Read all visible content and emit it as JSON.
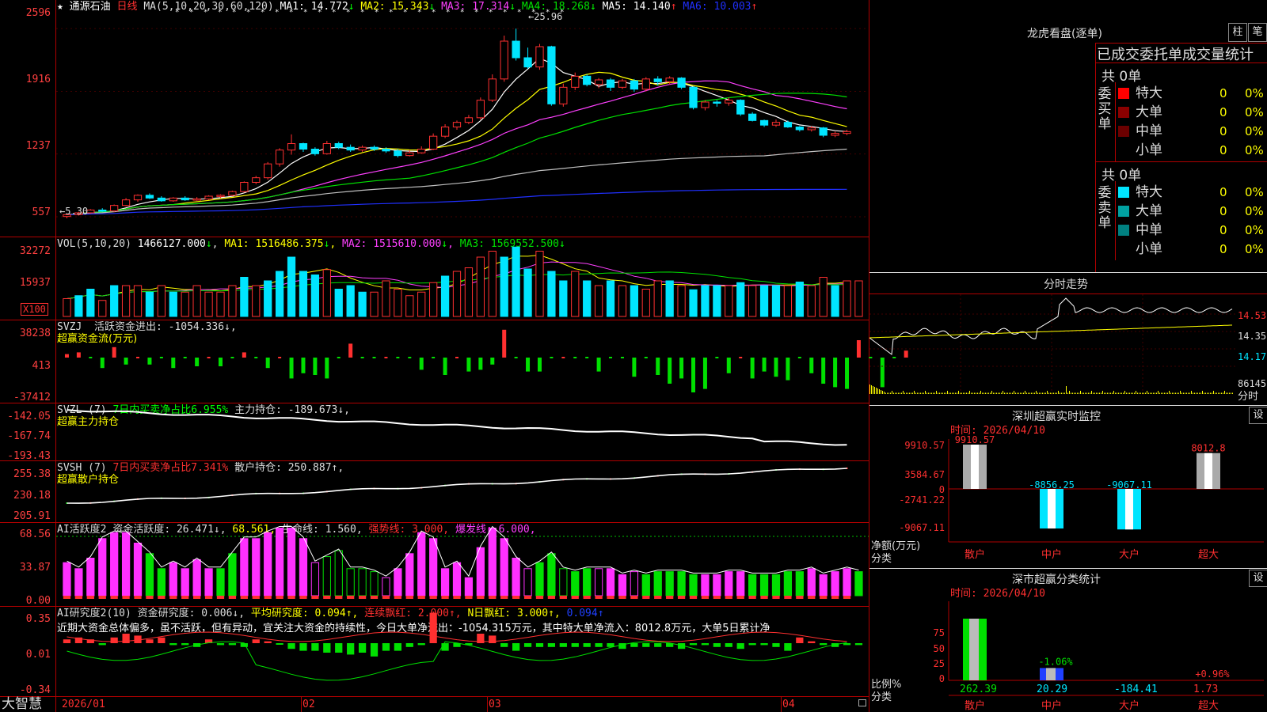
{
  "colors": {
    "up": "#ff3030",
    "down": "#00e5ff",
    "grid": "#b00000",
    "bg": "#000000",
    "ma1": "#ffffff",
    "ma2": "#ffff00",
    "ma3": "#ff40ff",
    "ma4": "#00e000",
    "ma5": "#c0c0c0",
    "ma6": "#2030ff"
  },
  "main": {
    "star": "★",
    "stock_name": "通源石油",
    "period": "日线",
    "ma_label": "MA(5,10,20,30,60,120)",
    "ma": [
      {
        "key": "MA1",
        "value": "14.772",
        "arrow": "↓"
      },
      {
        "key": "MA2",
        "value": "15.343",
        "arrow": "↓"
      },
      {
        "key": "MA3",
        "value": "17.314",
        "arrow": "↓"
      },
      {
        "key": "MA4",
        "value": "18.268",
        "arrow": "↓"
      },
      {
        "key": "MA5",
        "value": "14.140",
        "arrow": "↑"
      },
      {
        "key": "MA6",
        "value": "10.003",
        "arrow": "↑"
      }
    ],
    "high_label": "25.96",
    "low_label": "5.30",
    "axis": [
      "2596",
      "1916",
      "1237",
      "557"
    ]
  },
  "vol": {
    "header": "VOL(5,10,20)",
    "value": "1466127.000",
    "ma": [
      {
        "key": "MA1",
        "value": "1516486.375",
        "arrow": "↓"
      },
      {
        "key": "MA2",
        "value": "1515610.000",
        "arrow": "↓"
      },
      {
        "key": "MA3",
        "value": "1569552.500",
        "arrow": "↓"
      }
    ],
    "axis": [
      "32272",
      "15937"
    ],
    "unit": "X100"
  },
  "svzj": {
    "header": "SVZJ",
    "desc": "活跃资金进出: -1054.336↓,",
    "sub": "超赢资金流(万元)",
    "axis": [
      "38238",
      "413",
      "-37412"
    ]
  },
  "svzl": {
    "header": "SVZL (7)",
    "ratio": "7日内买卖净占比6.955%",
    "desc": "主力持仓: -189.673↓,",
    "sub": "超赢主力持仓",
    "axis": [
      "-142.05",
      "-167.74",
      "-193.43"
    ]
  },
  "svsh": {
    "header": "SVSH (7)",
    "ratio": "7日内买卖净占比7.341%",
    "desc": "散户持仓: 250.887↑,",
    "sub": "超赢散户持仓",
    "axis": [
      "255.38",
      "230.18",
      "205.91"
    ]
  },
  "ai1": {
    "header": "AI活跃度2",
    "a": "资金活跃度: 26.471↓,",
    "b": "68.561,",
    "c": "生命线: 1.560,",
    "d": "强势线: 3.000,",
    "e": "爆发线: 6.000,",
    "axis": [
      "68.56",
      "33.87",
      "0.00"
    ]
  },
  "ai2": {
    "header": "AI研究度2(10)",
    "a": "资金研究度: 0.006↓,",
    "b": "平均研究度: 0.094↑,",
    "c": "连续飘红: 2.000↑,",
    "d": "N日飘红: 3.000↑,",
    "e": "0.094↑",
    "comment": "近期大资金总体偏多，虽不活跃，但有异动，宜关注大资金的持续性，今日大单净流出：-1054.315万元，其中特大单净流入：8012.8万元，大单5日累计净",
    "axis": [
      "0.35",
      "0.01",
      "-0.34"
    ]
  },
  "bottom": {
    "brand": "大智慧",
    "dates": [
      "2026/01",
      "02",
      "03",
      "04"
    ]
  },
  "right": {
    "lhb_title": "龙虎看盘(逐单)",
    "btn_zhu": "柱",
    "btn_bi": "笔",
    "tabs": "已成交委托单成交量统计",
    "buy_side": "委买单",
    "sell_side": "委卖单",
    "buy_total": "共 0单",
    "sell_total": "共 0单",
    "buy_rows": [
      {
        "label": "特大",
        "n": "0",
        "p": "0%",
        "color": "#ff0000"
      },
      {
        "label": "大单",
        "n": "0",
        "p": "0%",
        "color": "#8b0000"
      },
      {
        "label": "中单",
        "n": "0",
        "p": "0%",
        "color": "#6b0000"
      },
      {
        "label": "小单",
        "n": "0",
        "p": "0%",
        "color": ""
      }
    ],
    "sell_rows": [
      {
        "label": "特大",
        "n": "0",
        "p": "0%",
        "color": "#00e5ff"
      },
      {
        "label": "大单",
        "n": "0",
        "p": "0%",
        "color": "#00a0a0"
      },
      {
        "label": "中单",
        "n": "0",
        "p": "0%",
        "color": "#008080"
      },
      {
        "label": "小单",
        "n": "0",
        "p": "0%",
        "color": ""
      }
    ],
    "fs_title": "分时走势",
    "fs_axis": [
      "14.53",
      "14.35",
      "14.17"
    ],
    "fs_vol": "86145",
    "fs_vol_unit": "分时",
    "sz_title": "深圳超赢实时监控",
    "sz_set": "设",
    "sz_time": "时间: 2026/04/10",
    "sz_axis": [
      "9910.57",
      "3584.67",
      "0",
      "-2741.22",
      "-9067.11"
    ],
    "sz_unit": "净额(万元)",
    "sz_cat_label": "分类",
    "sz_bars": [
      {
        "cat": "散户",
        "value": 9910.57,
        "label": "9910.57"
      },
      {
        "cat": "中户",
        "value": -8856.25,
        "label": "-8856.25"
      },
      {
        "cat": "大户",
        "value": -9067.11,
        "label": "-9067.11"
      },
      {
        "cat": "超大",
        "value": 8012.8,
        "label": "8012.8"
      }
    ],
    "sc_title": "深市超赢分类统计",
    "sc_set": "设",
    "sc_time": "时间: 2026/04/10",
    "sc_axis": [
      "75",
      "50",
      "25",
      "0"
    ],
    "sc_unit": "比例%",
    "sc_cat_label": "分类",
    "sc_bars": [
      {
        "cat": "散户",
        "pct": 100,
        "pct_label": "",
        "value": "262.39"
      },
      {
        "cat": "中户",
        "pct": 20,
        "pct_label": "-1.06%",
        "value": "20.29"
      },
      {
        "cat": "大户",
        "pct": 0,
        "pct_label": "",
        "value": "-184.41"
      },
      {
        "cat": "超大",
        "pct": 0,
        "pct_label": "+0.96%",
        "value": "1.73"
      }
    ]
  },
  "chart_data": {
    "type": "candlestick",
    "price_min": 5.3,
    "price_max": 25.96,
    "candles": [
      [
        5.6,
        5.8,
        5.4,
        5.9
      ],
      [
        5.8,
        6.0,
        5.7,
        6.1
      ],
      [
        6.0,
        6.3,
        5.9,
        6.4
      ],
      [
        6.3,
        6.2,
        6.1,
        6.5
      ],
      [
        6.2,
        6.8,
        6.1,
        6.9
      ],
      [
        6.8,
        7.4,
        6.7,
        7.6
      ],
      [
        7.4,
        7.9,
        7.2,
        8.0
      ],
      [
        7.9,
        7.6,
        7.5,
        8.1
      ],
      [
        7.6,
        7.3,
        7.2,
        7.8
      ],
      [
        7.3,
        7.6,
        7.2,
        7.7
      ],
      [
        7.6,
        7.4,
        7.3,
        7.8
      ],
      [
        7.4,
        7.5,
        7.3,
        7.7
      ],
      [
        7.5,
        7.8,
        7.4,
        7.9
      ],
      [
        7.8,
        7.9,
        7.6,
        8.0
      ],
      [
        7.9,
        8.3,
        7.8,
        8.4
      ],
      [
        8.3,
        9.3,
        8.2,
        9.4
      ],
      [
        9.3,
        9.8,
        9.1,
        10.0
      ],
      [
        9.8,
        11.3,
        9.6,
        11.5
      ],
      [
        11.3,
        12.8,
        11.0,
        13.0
      ],
      [
        12.8,
        13.5,
        12.3,
        14.5
      ],
      [
        13.5,
        12.9,
        12.6,
        13.6
      ],
      [
        12.9,
        12.4,
        12.2,
        13.1
      ],
      [
        12.4,
        13.5,
        12.3,
        13.8
      ],
      [
        13.5,
        13.1,
        12.9,
        13.7
      ],
      [
        13.1,
        12.8,
        12.6,
        13.4
      ],
      [
        12.8,
        13.1,
        12.6,
        13.3
      ],
      [
        13.1,
        12.9,
        12.7,
        13.3
      ],
      [
        12.9,
        12.7,
        12.5,
        13.1
      ],
      [
        12.7,
        12.2,
        12.0,
        12.9
      ],
      [
        12.2,
        12.5,
        12.1,
        12.8
      ],
      [
        12.5,
        12.9,
        12.4,
        13.2
      ],
      [
        12.9,
        14.3,
        12.8,
        14.6
      ],
      [
        14.3,
        15.3,
        14.1,
        15.6
      ],
      [
        15.3,
        15.8,
        15.0,
        16.0
      ],
      [
        15.8,
        16.3,
        15.6,
        16.6
      ],
      [
        16.3,
        18.2,
        16.1,
        18.5
      ],
      [
        18.2,
        20.5,
        18.0,
        21.0
      ],
      [
        20.5,
        24.6,
        20.2,
        25.2
      ],
      [
        24.6,
        22.8,
        22.5,
        25.96
      ],
      [
        22.8,
        21.8,
        21.6,
        23.9
      ],
      [
        21.8,
        24.0,
        21.5,
        24.3
      ],
      [
        24.0,
        17.8,
        17.6,
        24.1
      ],
      [
        17.8,
        19.6,
        17.5,
        20.0
      ],
      [
        19.6,
        20.8,
        19.3,
        21.2
      ],
      [
        20.8,
        19.9,
        19.7,
        21.0
      ],
      [
        19.9,
        20.4,
        19.5,
        20.6
      ],
      [
        20.4,
        19.6,
        19.2,
        20.6
      ],
      [
        19.6,
        20.3,
        19.4,
        20.5
      ],
      [
        20.3,
        19.4,
        19.1,
        20.5
      ],
      [
        19.4,
        20.5,
        19.2,
        20.7
      ],
      [
        20.5,
        20.2,
        19.8,
        20.8
      ],
      [
        20.2,
        20.6,
        19.9,
        20.8
      ],
      [
        20.6,
        19.6,
        19.4,
        20.7
      ],
      [
        19.6,
        17.4,
        17.2,
        19.7
      ],
      [
        17.4,
        18.0,
        17.1,
        18.2
      ],
      [
        18.0,
        17.9,
        17.5,
        18.2
      ],
      [
        17.9,
        18.2,
        17.6,
        18.5
      ],
      [
        18.2,
        16.7,
        16.5,
        18.3
      ],
      [
        16.7,
        16.0,
        15.9,
        16.9
      ],
      [
        16.0,
        15.5,
        15.3,
        16.1
      ],
      [
        15.5,
        15.8,
        15.3,
        16.1
      ],
      [
        15.8,
        15.3,
        15.2,
        16.0
      ],
      [
        15.3,
        15.0,
        14.8,
        15.4
      ],
      [
        15.0,
        15.2,
        14.8,
        15.4
      ],
      [
        15.2,
        14.4,
        14.2,
        15.3
      ],
      [
        14.4,
        14.6,
        14.2,
        14.8
      ],
      [
        14.6,
        14.8,
        14.4,
        15.0
      ]
    ],
    "volumes_pct": [
      30,
      35,
      46,
      27,
      52,
      52,
      52,
      41,
      52,
      41,
      41,
      52,
      41,
      41,
      52,
      66,
      52,
      60,
      76,
      100,
      76,
      70,
      79,
      46,
      52,
      41,
      41,
      60,
      46,
      35,
      41,
      57,
      68,
      76,
      82,
      100,
      110,
      100,
      117,
      80,
      110,
      76,
      60,
      76,
      60,
      52,
      60,
      52,
      52,
      46,
      60,
      60,
      52,
      45,
      52,
      52,
      52,
      57,
      52,
      52,
      52,
      52,
      58,
      52,
      66,
      52,
      60,
      60
    ],
    "volume_up": [
      1,
      0,
      0,
      1,
      0,
      1,
      1,
      0,
      1,
      0,
      1,
      1,
      1,
      1,
      1,
      0,
      1,
      0,
      0,
      0,
      0,
      0,
      1,
      0,
      0,
      0,
      1,
      1,
      1,
      1,
      1,
      1,
      0,
      1,
      1,
      1,
      1,
      0,
      0,
      0,
      1,
      0,
      0,
      1,
      0,
      1,
      0,
      1,
      0,
      1,
      1,
      0,
      1,
      0,
      0,
      0,
      1,
      0,
      1,
      0,
      0,
      1,
      0,
      1,
      1,
      0,
      1,
      1
    ],
    "svzj": [
      2,
      3,
      0,
      -6,
      6,
      -4,
      0,
      -4,
      0,
      -6,
      0,
      -5,
      0,
      -5,
      0,
      3,
      0,
      -6,
      0,
      -12,
      -9,
      -10,
      -12,
      0,
      8,
      0,
      0,
      0,
      0,
      0,
      -7,
      0,
      -10,
      0,
      -8,
      -7,
      -4,
      16,
      0,
      -8,
      -8,
      0,
      0,
      0,
      0,
      -8,
      0,
      0,
      -11,
      0,
      -10,
      -15,
      -12,
      -20,
      -18,
      0,
      -9,
      0,
      -12,
      -8,
      -11,
      -13,
      0,
      -9,
      -15,
      -17,
      -18,
      10,
      0,
      -17,
      0,
      4
    ]
  }
}
